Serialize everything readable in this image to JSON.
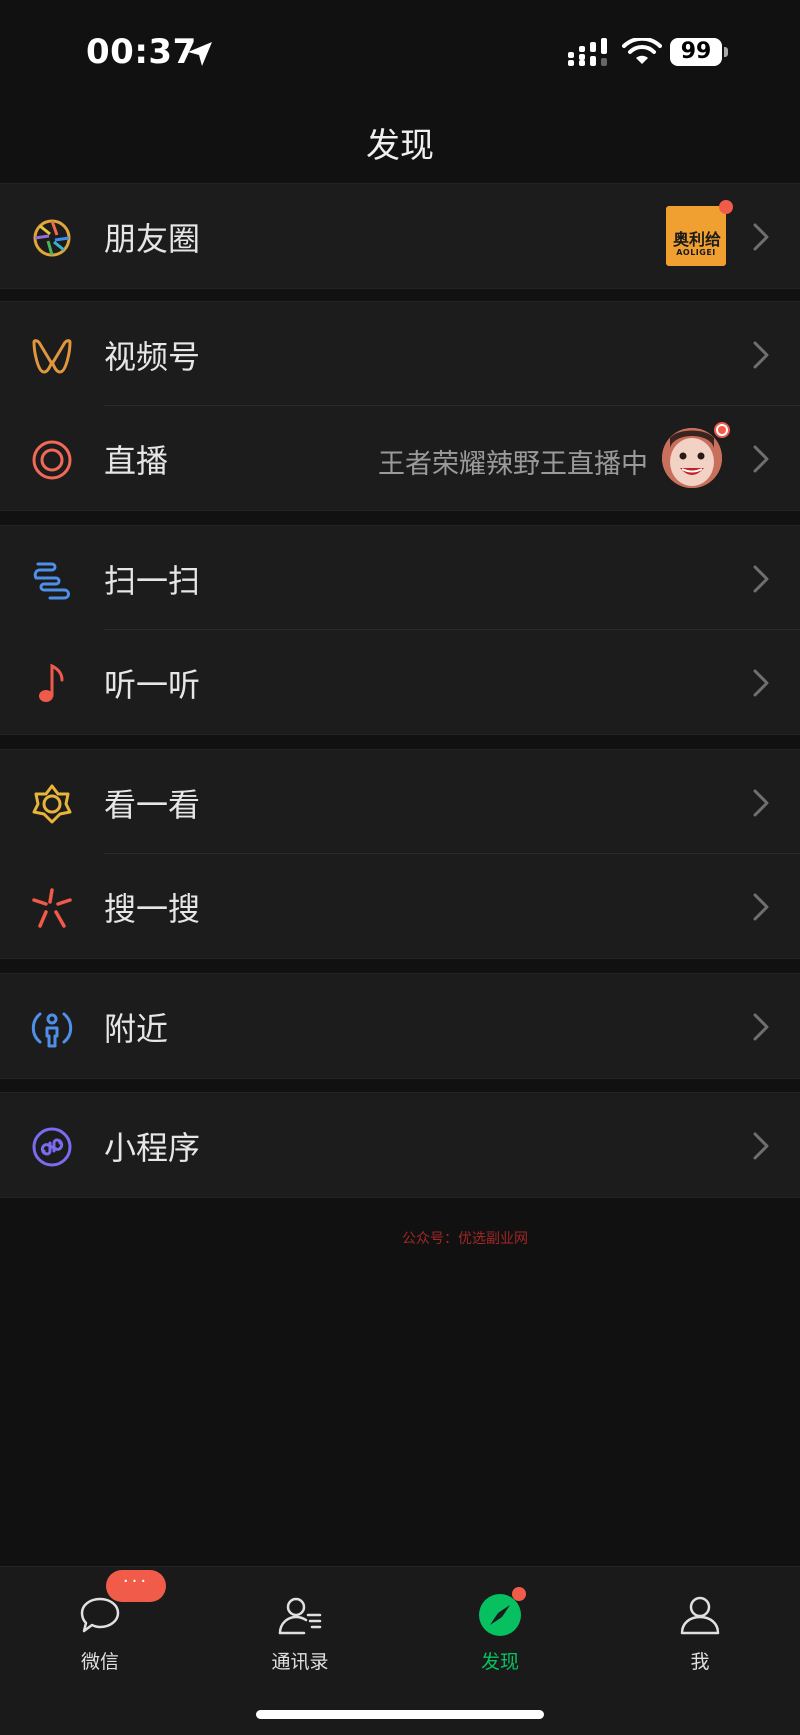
{
  "status_bar": {
    "time": "00:37",
    "battery": "99"
  },
  "nav": {
    "title": "发现"
  },
  "menu": {
    "moments": {
      "label": "朋友圈",
      "thumb_text": "奥利给",
      "thumb_subtext": "AOLIGEI"
    },
    "channels": {
      "label": "视频号"
    },
    "live": {
      "label": "直播",
      "subtext": "王者荣耀辣野王直播中"
    },
    "scan": {
      "label": "扫一扫"
    },
    "listen": {
      "label": "听一听"
    },
    "top_stories": {
      "label": "看一看"
    },
    "search": {
      "label": "搜一搜"
    },
    "nearby": {
      "label": "附近"
    },
    "mini_programs": {
      "label": "小程序"
    }
  },
  "watermark": "公众号：优选副业网",
  "tabbar": {
    "chats": {
      "label": "微信",
      "badge": "···"
    },
    "contacts": {
      "label": "通讯录"
    },
    "discover": {
      "label": "发现"
    },
    "me": {
      "label": "我"
    }
  },
  "colors": {
    "accent": "#07c160",
    "badge_red": "#f15b4a",
    "background": "#111111",
    "cell": "#1c1c1c"
  }
}
